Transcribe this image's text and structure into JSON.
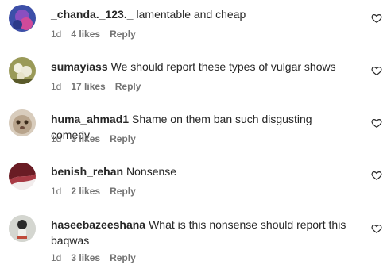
{
  "comments": [
    {
      "username": "_chanda._123._",
      "text": "lamentable and cheap",
      "time": "1d",
      "likes": "4 likes",
      "reply": "Reply",
      "avatar_color": "#4a4fb8"
    },
    {
      "username": "sumayiass",
      "text": "We should report these types of vulgar shows",
      "time": "1d",
      "likes": "17 likes",
      "reply": "Reply",
      "avatar_color": "#b8b070"
    },
    {
      "username": "huma_ahmad1",
      "text": "Shame on them ban such disgusting comedy",
      "time": "1d",
      "likes": "3 likes",
      "reply": "Reply",
      "avatar_color": "#c8b8a4"
    },
    {
      "username": "benish_rehan",
      "text": "Nonsense",
      "time": "1d",
      "likes": "2 likes",
      "reply": "Reply",
      "avatar_color": "#7a2a30"
    },
    {
      "username": "haseebazeeshana",
      "text": "What is this nonsense should report this baqwas",
      "time": "1d",
      "likes": "3 likes",
      "reply": "Reply",
      "avatar_color": "#cfd2cc"
    }
  ],
  "icons": {
    "like": "heart-outline-icon"
  }
}
